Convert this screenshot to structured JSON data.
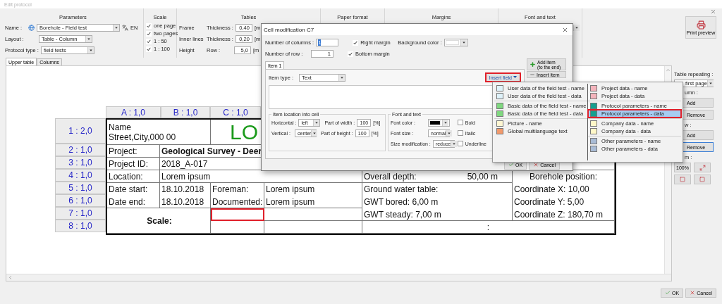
{
  "window": {
    "title": "Edit protocol"
  },
  "toolbar": {
    "parameters": {
      "title": "Parameters",
      "name_label": "Name :",
      "name_value": "Borehole - Field test",
      "language": "EN",
      "layout_label": "Layout :",
      "layout_value": "Table - Column",
      "type_label": "Protocol type :",
      "type_value": "field tests"
    },
    "scale": {
      "title": "Scale",
      "options": [
        {
          "label": "one page",
          "checked": true
        },
        {
          "label": "two pages",
          "checked": true
        },
        {
          "label": "1 : 50",
          "checked": true
        },
        {
          "label": "1 : 100",
          "checked": true
        }
      ]
    },
    "tables": {
      "title": "Tables",
      "rows": [
        {
          "label": "Frame",
          "field_label": "Thickness :",
          "value": "0,40",
          "unit": "[m"
        },
        {
          "label": "Inner lines",
          "field_label": "Thickness :",
          "value": "0,20",
          "unit": "[m"
        },
        {
          "label": "Height",
          "field_label": "Row :",
          "value": "5,0",
          "unit": "[m"
        }
      ]
    },
    "headers": [
      "Paper format",
      "Margins",
      "Font and text"
    ],
    "print_preview": "Print preview"
  },
  "tabs": [
    {
      "label": "Upper table",
      "selected": true
    },
    {
      "label": "Columns",
      "selected": false
    }
  ],
  "document": {
    "columns": [
      "A : 1,0",
      "B : 1,0",
      "C : 1,0"
    ],
    "rows": [
      {
        "header": "1 : 2,0",
        "cells": [
          {
            "kind": "lines",
            "lines": [
              "Name",
              "Street,City,000 00"
            ],
            "selected": false
          },
          {
            "kind": "merged"
          },
          {
            "kind": "logo",
            "text": "LO",
            "selected": false
          },
          {
            "kind": "merged"
          },
          {
            "kind": "merged"
          },
          {
            "kind": "merged"
          }
        ]
      },
      {
        "header": "2 : 1,0",
        "cells": [
          {
            "kind": "label",
            "text": "Project:",
            "selected": false
          },
          {
            "kind": "bold",
            "text": "Geological Survey - Deer",
            "selected": false
          },
          {
            "kind": "merged"
          },
          {
            "kind": "merged"
          },
          {
            "kind": "merged"
          },
          {
            "kind": "merged"
          }
        ]
      },
      {
        "header": "3 : 1,0",
        "cells": [
          {
            "kind": "label",
            "text": "Project ID:",
            "selected": false
          },
          {
            "kind": "label",
            "text": "2018_A-017",
            "selected": false
          },
          {
            "kind": "merged"
          },
          {
            "kind": "merged"
          },
          {
            "kind": "merged"
          },
          {
            "kind": "merged"
          }
        ]
      },
      {
        "header": "4 : 1,0",
        "cells": [
          {
            "kind": "label",
            "text": "Location:",
            "selected": false
          },
          {
            "kind": "label",
            "text": "Lorem ipsum",
            "selected": false
          },
          {
            "kind": "merged"
          },
          {
            "kind": "merged"
          },
          {
            "kind": "pair",
            "text": "Overall depth:",
            "value": "50,00 m",
            "selected": false
          },
          {
            "kind": "center",
            "text": "Borehole position:",
            "selected": false
          }
        ]
      },
      {
        "header": "5 : 1,0",
        "cells": [
          {
            "kind": "label",
            "text": "Date start:",
            "selected": false
          },
          {
            "kind": "label",
            "text": "18.10.2018",
            "selected": false
          },
          {
            "kind": "label",
            "text": "Foreman:",
            "selected": false
          },
          {
            "kind": "label",
            "text": "Lorem ipsum",
            "selected": false
          },
          {
            "kind": "label",
            "text": "Ground water table:",
            "selected": false
          },
          {
            "kind": "label",
            "text": "Coordinate X:  10,00",
            "selected": false
          }
        ]
      },
      {
        "header": "6 : 1,0",
        "cells": [
          {
            "kind": "label",
            "text": "Date end:",
            "selected": false
          },
          {
            "kind": "label",
            "text": "18.10.2018",
            "selected": false
          },
          {
            "kind": "label",
            "text": "Documented:",
            "selected": false
          },
          {
            "kind": "label",
            "text": "Lorem ipsum",
            "selected": false
          },
          {
            "kind": "label",
            "text": "GWT bored:  6,00 m",
            "selected": false
          },
          {
            "kind": "label",
            "text": "Coordinate Y:  5,00",
            "selected": false
          }
        ]
      },
      {
        "header": "7 : 1,0",
        "cells": [
          {
            "kind": "heading",
            "text": "Scale:",
            "selected": false
          },
          {
            "kind": "merged"
          },
          {
            "kind": "empty",
            "selected": true
          },
          {
            "kind": "empty",
            "selected": false
          },
          {
            "kind": "label",
            "text": "GWT steady:  7,00 m",
            "selected": false
          },
          {
            "kind": "label",
            "text": "Coordinate Z:  180,70 m",
            "selected": false
          }
        ]
      },
      {
        "header": "8 : 1,0",
        "cells": [
          {
            "kind": "merged_up"
          },
          {
            "kind": "merged_up"
          },
          {
            "kind": "empty",
            "selected": false
          },
          {
            "kind": "empty",
            "selected": false
          },
          {
            "kind": "center",
            "text": ":",
            "selected": false
          },
          {
            "kind": "merged"
          }
        ]
      }
    ]
  },
  "side_panel": {
    "repeat_label": "Table repeating :",
    "repeat_value": "first page",
    "sections": [
      {
        "label": "umn :",
        "buttons": [
          {
            "label": "Add",
            "selected": false
          },
          {
            "label": "Remove",
            "selected": false
          }
        ]
      },
      {
        "label": "w :",
        "buttons": [
          {
            "label": "Add",
            "selected": false
          },
          {
            "label": "Remove",
            "selected": true
          }
        ]
      },
      {
        "label": "m :"
      }
    ],
    "zoom": "100%"
  },
  "dialog": {
    "title": "Cell modification C7",
    "columns_label": "Number of columns :",
    "columns_value": "1",
    "rows_label": "Number of row :",
    "rows_value": "1",
    "margins": [
      {
        "label": "Right margin",
        "checked": true
      },
      {
        "label": "Bottom margin",
        "checked": true
      }
    ],
    "background_label": "Background color :",
    "item_tabs": [
      {
        "label": "Item 1",
        "selected": true
      }
    ],
    "add_item": [
      "Add item",
      "(to the end)"
    ],
    "insert_item": "Insert item",
    "item_type_label": "Item type :",
    "item_type_value": "Text",
    "insert_field": {
      "label": "Insert field",
      "highlighted": true
    },
    "location": {
      "title": "Item location into cell",
      "rows": [
        {
          "label": "Horizontal :",
          "value": "left",
          "part_label": "Part of width :",
          "part_value": "100",
          "unit": "[%]"
        },
        {
          "label": "Vertical :",
          "value": "center",
          "part_label": "Part of height :",
          "part_value": "100",
          "unit": "[%]"
        }
      ]
    },
    "font": {
      "title": "Font and text",
      "color_label": "Font color :",
      "size_label": "Font size :",
      "size_value": "normal",
      "modification_label": "Size modification :",
      "modification_value": "reduce",
      "styles": [
        {
          "label": "Bold",
          "checked": false
        },
        {
          "label": "Italic",
          "checked": false
        },
        {
          "label": "Underline",
          "checked": false
        }
      ]
    },
    "ok": "OK",
    "cancel": "Cancel"
  },
  "insert_menu": {
    "columns": [
      {
        "groups": [
          {
            "items": [
              {
                "label": "User data of the field test - name",
                "color": "#dff2fa",
                "selected": false
              },
              {
                "label": "User data of the field test - data",
                "color": "#dff2fa",
                "selected": false
              }
            ]
          },
          {
            "items": [
              {
                "label": "Basic data of the field test - name",
                "color": "#80d880",
                "selected": false
              },
              {
                "label": "Basic data of the field test - data",
                "color": "#80d880",
                "selected": false
              }
            ]
          },
          {
            "items": [
              {
                "label": "Picture - name",
                "color": "#fff6d2",
                "selected": false
              },
              {
                "label": "Global multilanguage text",
                "color": "#f29a6c",
                "selected": false
              }
            ]
          }
        ]
      },
      {
        "groups": [
          {
            "items": [
              {
                "label": "Project data - name",
                "color": "#f4b4bc",
                "selected": false
              },
              {
                "label": "Project data - data",
                "color": "#f4b4bc",
                "selected": false
              }
            ]
          },
          {
            "items": [
              {
                "label": "Protocol parameters - name",
                "color": "#15a090",
                "selected": false
              },
              {
                "label": "Protocol parameters - data",
                "color": "#15a090",
                "selected": true
              }
            ]
          },
          {
            "items": [
              {
                "label": "Company data - name",
                "color": "#fff8c8",
                "selected": false
              },
              {
                "label": "Company data - data",
                "color": "#fff8c8",
                "selected": false
              }
            ]
          },
          {
            "items": [
              {
                "label": "Other parameters - name",
                "color": "#a9bcd6",
                "selected": false
              },
              {
                "label": "Other parameters - data",
                "color": "#a9bcd6",
                "selected": false
              }
            ]
          }
        ]
      }
    ]
  },
  "footer": {
    "ok": "OK",
    "cancel": "Cancel"
  }
}
